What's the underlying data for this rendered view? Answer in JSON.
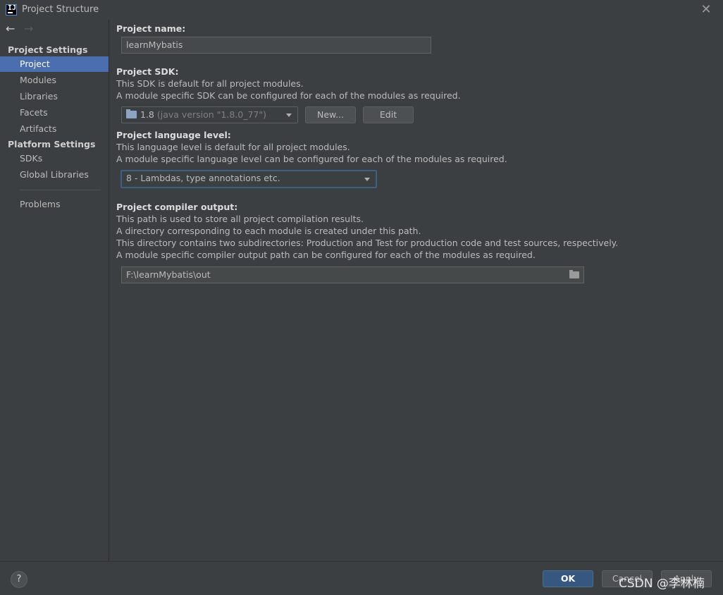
{
  "window": {
    "title": "Project Structure",
    "close_glyph": "✕"
  },
  "nav": {
    "back_glyph": "←",
    "forward_glyph": "→"
  },
  "sidebar": {
    "project_settings_header": "Project Settings",
    "platform_settings_header": "Platform Settings",
    "items": [
      {
        "label": "Project"
      },
      {
        "label": "Modules"
      },
      {
        "label": "Libraries"
      },
      {
        "label": "Facets"
      },
      {
        "label": "Artifacts"
      },
      {
        "label": "SDKs"
      },
      {
        "label": "Global Libraries"
      },
      {
        "label": "Problems"
      }
    ],
    "selected": "Project"
  },
  "main": {
    "project_name": {
      "label": "Project name:",
      "value": "learnMybatis"
    },
    "project_sdk": {
      "label": "Project SDK:",
      "desc1": "This SDK is default for all project modules.",
      "desc2": "A module specific SDK can be configured for each of the modules as required.",
      "sdk_version": "1.8",
      "sdk_detail": "(java version \"1.8.0_77\")",
      "new_button": "New...",
      "edit_button": "Edit"
    },
    "language_level": {
      "label": "Project language level:",
      "desc1": "This language level is default for all project modules.",
      "desc2": "A module specific language level can be configured for each of the modules as required.",
      "value": "8 - Lambdas, type annotations etc."
    },
    "compiler_output": {
      "label": "Project compiler output:",
      "desc1": "This path is used to store all project compilation results.",
      "desc2": "A directory corresponding to each module is created under this path.",
      "desc3": "This directory contains two subdirectories: Production and Test for production code and test sources, respectively.",
      "desc4": "A module specific compiler output path can be configured for each of the modules as required.",
      "path": "F:\\learnMybatis\\out"
    }
  },
  "footer": {
    "help_glyph": "?",
    "ok_button": "OK",
    "cancel_button": "Cancel",
    "apply_button": "Apply",
    "watermark": "CSDN @李林楠"
  },
  "colors": {
    "background": "#3c3f41",
    "selection": "#4b6eaf",
    "ok_button": "#365880",
    "focus_border": "#3d6185"
  },
  "icons": [
    "app-logo-icon",
    "close-icon",
    "back-arrow-icon",
    "forward-arrow-icon",
    "sdk-folder-icon",
    "dropdown-arrow-icon",
    "browse-folder-icon",
    "help-icon"
  ]
}
